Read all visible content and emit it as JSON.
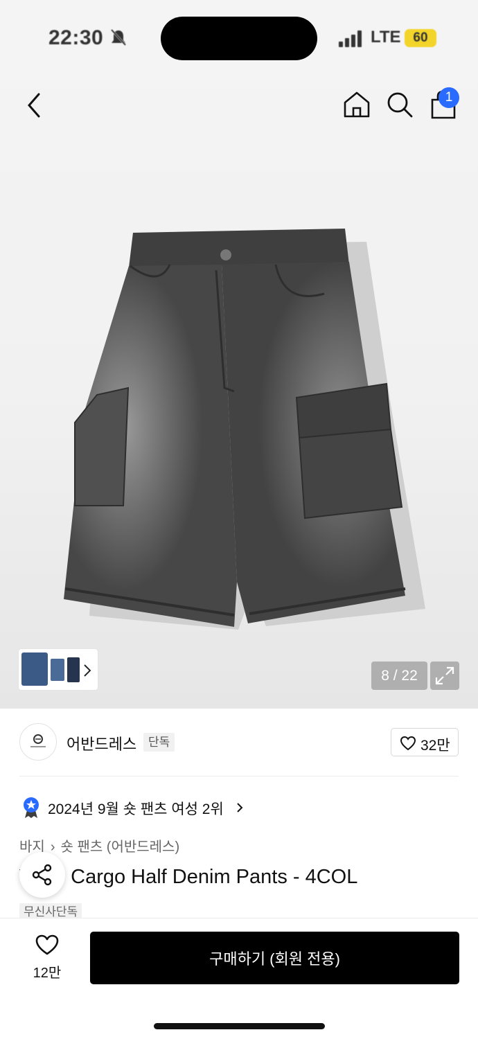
{
  "status_bar": {
    "time": "22:30",
    "network": "LTE",
    "battery": "60"
  },
  "header": {
    "cart_count": "1"
  },
  "gallery": {
    "counter": "8 / 22"
  },
  "brand": {
    "name": "어반드레스",
    "tag": "단독",
    "likes": "32만"
  },
  "ranking": {
    "text": "2024년 9월 숏 팬츠 여성 2위"
  },
  "breadcrumb": {
    "category": "바지",
    "subcategory": "숏 팬츠 (어반드레스)"
  },
  "product": {
    "title": "Wide Cargo Half Denim Pants - 4COL",
    "tag": "무신사단독"
  },
  "bottom_bar": {
    "wish_count": "12만",
    "buy_label": "구매하기 (회원 전용)"
  },
  "icons": {
    "back": "chevron-left-icon",
    "home": "home-icon",
    "search": "search-icon",
    "cart": "shopping-bag-icon",
    "share": "share-icon",
    "heart": "heart-icon",
    "expand": "expand-icon"
  },
  "colors": {
    "badge_blue": "#2a6bff",
    "buy_button": "#000000",
    "battery": "#f3d42b"
  }
}
